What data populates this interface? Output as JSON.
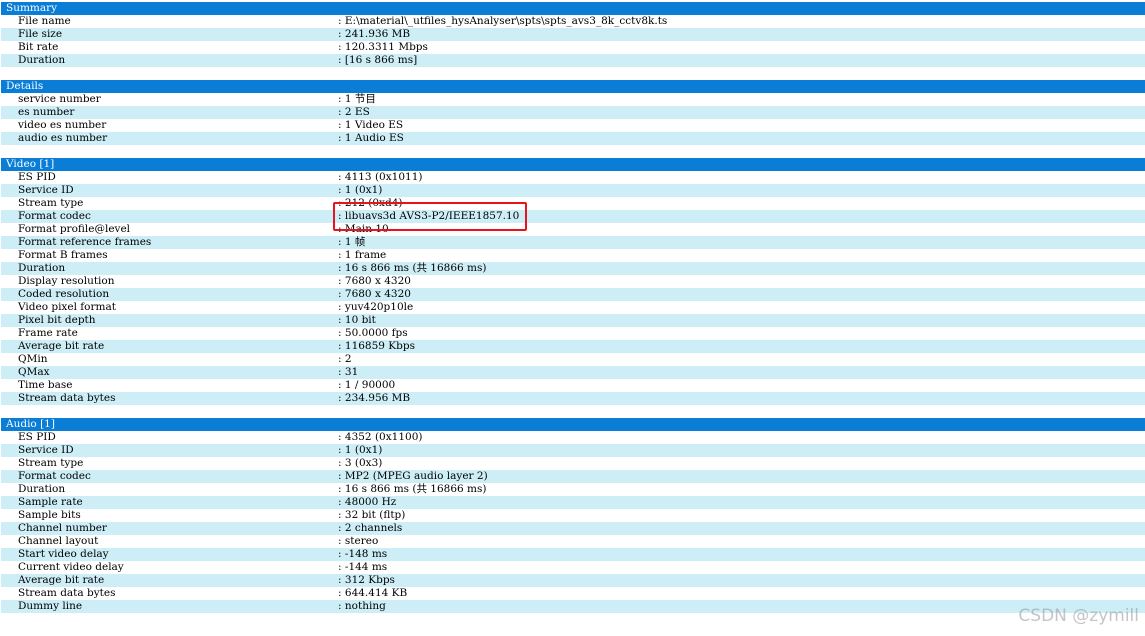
{
  "sections": [
    {
      "title": "Summary",
      "rows": [
        {
          "k": "File name",
          "v": "E:\\material\\_utfiles_hysAnalyser\\spts\\spts_avs3_8k_cctv8k.ts"
        },
        {
          "k": "File size",
          "v": "241.936 MB"
        },
        {
          "k": "Bit rate",
          "v": "120.3311 Mbps"
        },
        {
          "k": "Duration",
          "v": "[16 s 866 ms]"
        }
      ]
    },
    {
      "title": "Details",
      "rows": [
        {
          "k": "service number",
          "v": "1 节目"
        },
        {
          "k": "es number",
          "v": "2 ES"
        },
        {
          "k": "video es number",
          "v": "1 Video ES"
        },
        {
          "k": "audio es number",
          "v": "1 Audio ES"
        }
      ]
    },
    {
      "title": "Video [1]",
      "rows": [
        {
          "k": "ES PID",
          "v": "4113 (0x1011)"
        },
        {
          "k": "Service ID",
          "v": "1 (0x1)"
        },
        {
          "k": "Stream type",
          "v": "212 (0xd4)"
        },
        {
          "k": "Format codec",
          "v": "libuavs3d AVS3-P2/IEEE1857.10"
        },
        {
          "k": "Format profile@level",
          "v": "Main 10"
        },
        {
          "k": "Format reference frames",
          "v": "1 帧"
        },
        {
          "k": "Format B frames",
          "v": "1 frame"
        },
        {
          "k": "Duration",
          "v": "16 s 866 ms (共 16866 ms)"
        },
        {
          "k": "Display resolution",
          "v": "7680 x 4320"
        },
        {
          "k": "Coded resolution",
          "v": "7680 x 4320"
        },
        {
          "k": "Video pixel format",
          "v": "yuv420p10le"
        },
        {
          "k": "Pixel bit depth",
          "v": "10 bit"
        },
        {
          "k": "Frame rate",
          "v": "50.0000 fps"
        },
        {
          "k": "Average bit rate",
          "v": "116859 Kbps"
        },
        {
          "k": "QMin",
          "v": "2"
        },
        {
          "k": "QMax",
          "v": "31"
        },
        {
          "k": "Time base",
          "v": "1 / 90000"
        },
        {
          "k": "Stream data bytes",
          "v": "234.956 MB"
        }
      ]
    },
    {
      "title": "Audio [1]",
      "rows": [
        {
          "k": "ES PID",
          "v": "4352 (0x1100)"
        },
        {
          "k": "Service ID",
          "v": "1 (0x1)"
        },
        {
          "k": "Stream type",
          "v": "3 (0x3)"
        },
        {
          "k": "Format codec",
          "v": "MP2 (MPEG audio layer 2)"
        },
        {
          "k": "Duration",
          "v": "16 s 866 ms (共 16866 ms)"
        },
        {
          "k": "Sample rate",
          "v": "48000 Hz"
        },
        {
          "k": "Sample bits",
          "v": "32 bit (fltp)"
        },
        {
          "k": "Channel number",
          "v": "2 channels"
        },
        {
          "k": "Channel layout",
          "v": "stereo"
        },
        {
          "k": "Start video delay",
          "v": "-148 ms"
        },
        {
          "k": "Current video delay",
          "v": "-144 ms"
        },
        {
          "k": "Average bit rate",
          "v": "312 Kbps"
        },
        {
          "k": "Stream data bytes",
          "v": "644.414 KB"
        },
        {
          "k": "Dummy line",
          "v": "nothing"
        }
      ]
    }
  ],
  "watermark": "CSDN @zymill",
  "colors": {
    "header_bg": "#0a7dd6",
    "alt_row_bg": "#cdeef6",
    "highlight_border": "#e8141c"
  }
}
